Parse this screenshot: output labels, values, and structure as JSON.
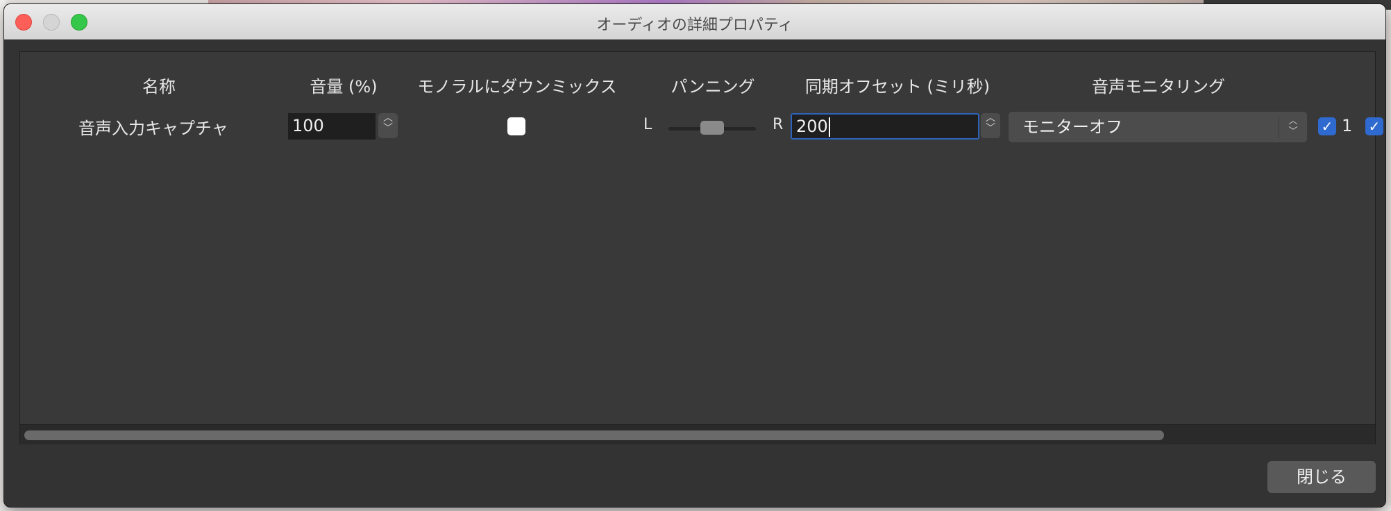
{
  "window": {
    "title": "オーディオの詳細プロパティ"
  },
  "columns": {
    "name": "名称",
    "volume": "音量 (%)",
    "mono": "モノラルにダウンミックス",
    "panning": "パンニング",
    "sync_offset": "同期オフセット (ミリ秒)",
    "monitoring": "音声モニタリング"
  },
  "rows": [
    {
      "name": "音声入力キャプチャ",
      "volume": "100",
      "mono_checked": false,
      "pan_left": "L",
      "pan_right": "R",
      "pan_value": 0.5,
      "sync_offset": "200",
      "monitoring": "モニターオフ",
      "track_checked": [
        true,
        true
      ],
      "track_label": "1"
    }
  ],
  "icons": {
    "checkmark": "✓",
    "up": "︿",
    "down": "﹀"
  },
  "buttons": {
    "close": "閉じる"
  },
  "colors": {
    "accent": "#2f6ad0",
    "close_red": "#fc5f57",
    "maximize_green": "#34c749"
  }
}
